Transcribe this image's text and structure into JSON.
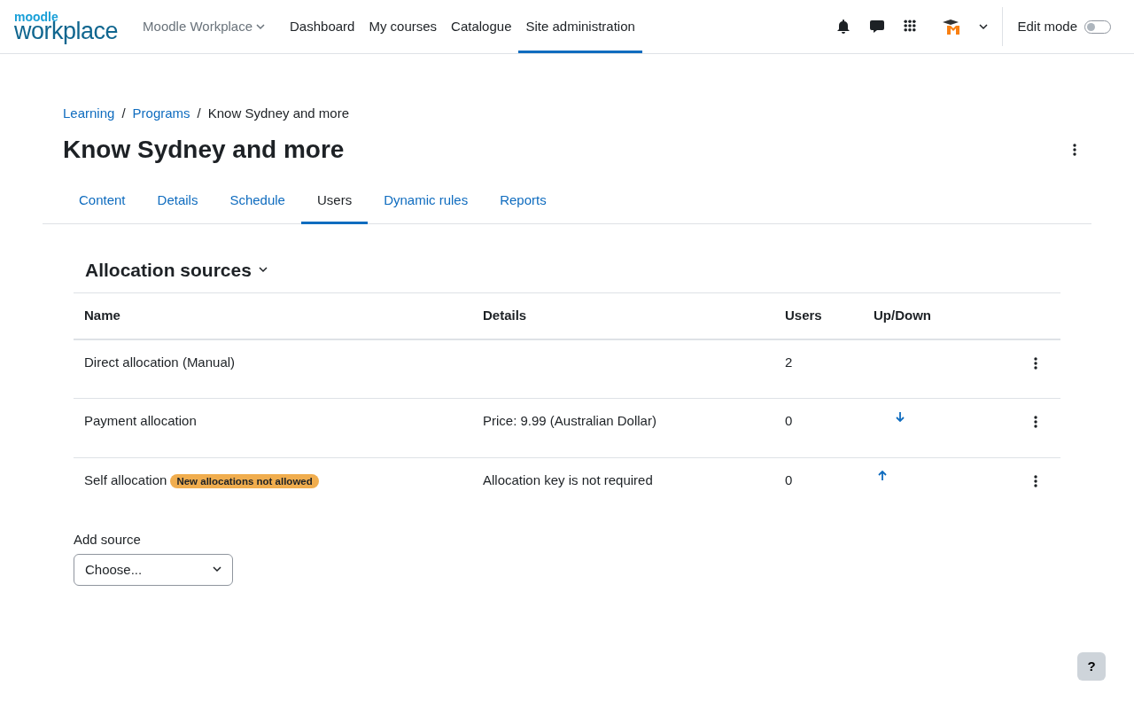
{
  "logo": {
    "top": "moodle",
    "bottom": "workplace"
  },
  "nav": {
    "menu": "Moodle Workplace",
    "links": [
      {
        "label": "Dashboard",
        "selected": false
      },
      {
        "label": "My courses",
        "selected": false
      },
      {
        "label": "Catalogue",
        "selected": false
      },
      {
        "label": "Site administration",
        "selected": true
      }
    ],
    "edit_mode": {
      "label": "Edit mode",
      "on": false
    }
  },
  "breadcrumb_separator": "/",
  "breadcrumb": [
    {
      "label": "Learning",
      "link": true
    },
    {
      "label": "Programs",
      "link": true
    },
    {
      "label": "Know Sydney and more",
      "link": false
    }
  ],
  "title": "Know Sydney and more",
  "tabs": [
    {
      "label": "Content",
      "selected": false
    },
    {
      "label": "Details",
      "selected": false
    },
    {
      "label": "Schedule",
      "selected": false
    },
    {
      "label": "Users",
      "selected": true
    },
    {
      "label": "Dynamic rules",
      "selected": false
    },
    {
      "label": "Reports",
      "selected": false
    }
  ],
  "section": {
    "title": "Allocation sources",
    "expanded": true
  },
  "table": {
    "columns": [
      "Name",
      "Details",
      "Users",
      "Up/Down"
    ],
    "rows": [
      {
        "name": "Direct allocation (Manual)",
        "badge": null,
        "details": "",
        "users": "2",
        "can_move_up": false,
        "can_move_down": false
      },
      {
        "name": "Payment allocation",
        "badge": null,
        "details": "Price: 9.99 (Australian Dollar)",
        "users": "0",
        "can_move_up": false,
        "can_move_down": true
      },
      {
        "name": "Self allocation",
        "badge": "New allocations not allowed",
        "details": "Allocation key is not required",
        "users": "0",
        "can_move_up": true,
        "can_move_down": false
      }
    ]
  },
  "add_source": {
    "label": "Add source",
    "value": "Choose..."
  },
  "help": "?"
}
